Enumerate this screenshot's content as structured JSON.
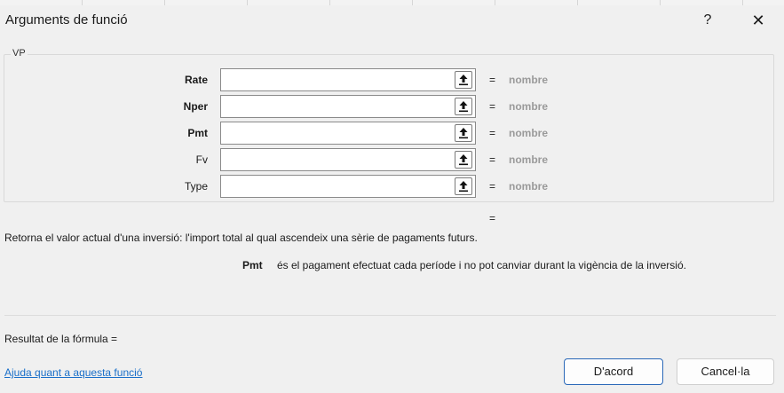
{
  "dialog": {
    "title": "Arguments de funció",
    "help_glyph": "?",
    "close_glyph": "✕"
  },
  "group": {
    "label": "VP"
  },
  "args": [
    {
      "label": "Rate",
      "required": true,
      "value": "",
      "equals": "=",
      "result": "nombre"
    },
    {
      "label": "Nper",
      "required": true,
      "value": "",
      "equals": "=",
      "result": "nombre"
    },
    {
      "label": "Pmt",
      "required": true,
      "value": "",
      "equals": "=",
      "result": "nombre"
    },
    {
      "label": "Fv",
      "required": false,
      "value": "",
      "equals": "=",
      "result": "nombre"
    },
    {
      "label": "Type",
      "required": false,
      "value": "",
      "equals": "=",
      "result": "nombre"
    }
  ],
  "function_result_equals": "=",
  "description": "Retorna el valor actual d'una inversió: l'import total al qual ascendeix una sèrie de pagaments futurs.",
  "current_param": {
    "name": "Pmt",
    "description": "és el pagament efectuat cada període i no pot canviar durant la vigència de la inversió."
  },
  "formula_result_label": "Resultat de la fórmula =",
  "help_link": "Ajuda quant a aquesta funció",
  "buttons": {
    "ok": "D'acord",
    "cancel": "Cancel·la"
  },
  "icons": {
    "ref_button": "collapse-dialog-arrow-up-icon"
  },
  "colors": {
    "link": "#1a6fc9",
    "ok_border": "#2a68b8",
    "result_type": "#9a9a9a"
  }
}
